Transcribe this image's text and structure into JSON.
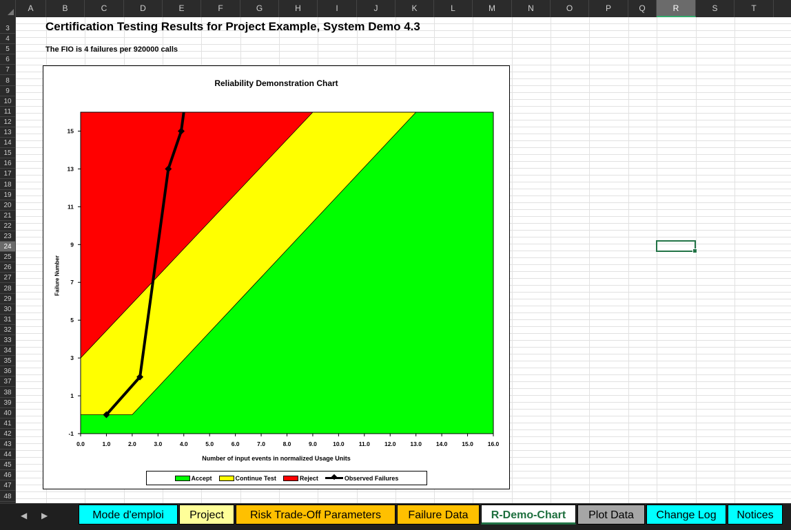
{
  "columns": [
    "A",
    "B",
    "C",
    "D",
    "E",
    "F",
    "G",
    "H",
    "I",
    "J",
    "K",
    "L",
    "M",
    "N",
    "O",
    "P",
    "Q",
    "R",
    "S",
    "T"
  ],
  "selected_column": "R",
  "rows": [
    "3",
    "4",
    "5",
    "6",
    "7",
    "8",
    "9",
    "10",
    "11",
    "12",
    "13",
    "14",
    "15",
    "16",
    "17",
    "18",
    "19",
    "20",
    "21",
    "22",
    "23",
    "24",
    "25",
    "26",
    "27",
    "28",
    "29",
    "30",
    "31",
    "32",
    "33",
    "34",
    "35",
    "36",
    "37",
    "38",
    "39",
    "40",
    "41",
    "42",
    "43",
    "44",
    "45",
    "46",
    "47",
    "48"
  ],
  "selected_row": "24",
  "sheet": {
    "title": "Certification Testing Results for Project Example, System Demo 4.3",
    "fio_text": "The FIO is 4 failures per 920000 calls"
  },
  "chart_data": {
    "type": "line",
    "title": "Reliability Demonstration Chart",
    "xlabel": "Number of input events in normalized Usage Units",
    "ylabel": "Failure Number",
    "xlim": [
      0,
      16
    ],
    "ylim": [
      -1,
      16
    ],
    "x_ticks": [
      "0.0",
      "1.0",
      "2.0",
      "3.0",
      "4.0",
      "5.0",
      "6.0",
      "7.0",
      "8.0",
      "9.0",
      "10.0",
      "11.0",
      "12.0",
      "13.0",
      "14.0",
      "15.0",
      "16.0"
    ],
    "y_ticks": [
      "-1",
      "1",
      "3",
      "5",
      "7",
      "9",
      "11",
      "13",
      "15"
    ],
    "regions": [
      {
        "name": "Accept",
        "color": "#00ff00"
      },
      {
        "name": "Continue Test",
        "color": "#ffff00"
      },
      {
        "name": "Reject",
        "color": "#ff0000"
      }
    ],
    "reject_boundary": [
      [
        0,
        3
      ],
      [
        9,
        16
      ]
    ],
    "accept_boundary": [
      [
        0,
        0
      ],
      [
        2,
        0
      ],
      [
        13,
        16
      ]
    ],
    "series": [
      {
        "name": "Observed Failures",
        "x": [
          1.0,
          2.3,
          3.4,
          3.9,
          4.0
        ],
        "y": [
          0,
          2,
          13,
          15,
          16
        ]
      }
    ],
    "legend": [
      "Accept",
      "Continue Test",
      "Reject",
      "Observed Failures"
    ],
    "legend_position": "bottom"
  },
  "tabs": [
    {
      "label": "Mode d'emploi",
      "color": "#00ffff"
    },
    {
      "label": "Project",
      "color": "#ffff99"
    },
    {
      "label": "Risk Trade-Off Parameters",
      "color": "#ffc000"
    },
    {
      "label": "Failure Data",
      "color": "#ffc000"
    },
    {
      "label": "R-Demo-Chart",
      "color": "#ffffff",
      "active": true
    },
    {
      "label": "Plot Data",
      "color": "#a6a6a6"
    },
    {
      "label": "Change Log",
      "color": "#00ffff"
    },
    {
      "label": "Notices",
      "color": "#00ffff"
    }
  ]
}
